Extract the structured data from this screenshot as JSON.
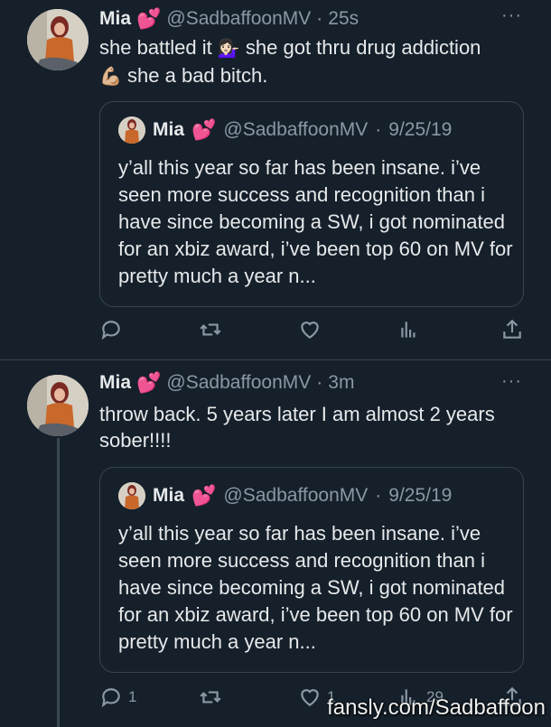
{
  "tweets": [
    {
      "name": "Mia",
      "heart": "💕",
      "handle": "@SadbaffoonMV",
      "time": "25s",
      "more": "···",
      "text_a": "she battled it",
      "emoji_1": "💁🏻‍♀️",
      "text_b": "she got thru drug addiction",
      "emoji_2": "💪🏼",
      "text_c": "she a bad bitch.",
      "quote": {
        "name": "Mia",
        "heart": "💕",
        "handle": "@SadbaffoonMV",
        "date": "9/25/19",
        "text": "y’all this year so far has been insane. i’ve seen more success and recognition than i have since becoming a SW, i got nominated for an xbiz award, i’ve been top 60 on MV for pretty much a year n..."
      },
      "actions": {
        "reply": "",
        "retweet": "",
        "like": "",
        "views": ""
      }
    },
    {
      "name": "Mia",
      "heart": "💕",
      "handle": "@SadbaffoonMV",
      "time": "3m",
      "more": "···",
      "text": "throw back. 5 years later I am almost 2 years sober!!!!",
      "quote": {
        "name": "Mia",
        "heart": "💕",
        "handle": "@SadbaffoonMV",
        "date": "9/25/19",
        "text": "y’all this year so far has been insane. i’ve seen more success and recognition than i have since becoming a SW, i got nominated for an xbiz award, i’ve been top 60 on MV for pretty much a year n..."
      },
      "actions": {
        "reply": "1",
        "retweet": "",
        "like": "1",
        "views": "29"
      }
    }
  ],
  "separator": "·",
  "watermark": "fansly.com/Sadbaffoon",
  "colors": {
    "background": "#15202b",
    "text": "#e7e9ea",
    "muted": "#8b98a5",
    "border": "#38444d",
    "heart": "#f3458f"
  },
  "icons": [
    "more-icon",
    "reply-icon",
    "retweet-icon",
    "like-icon",
    "views-icon",
    "share-icon",
    "avatar"
  ]
}
